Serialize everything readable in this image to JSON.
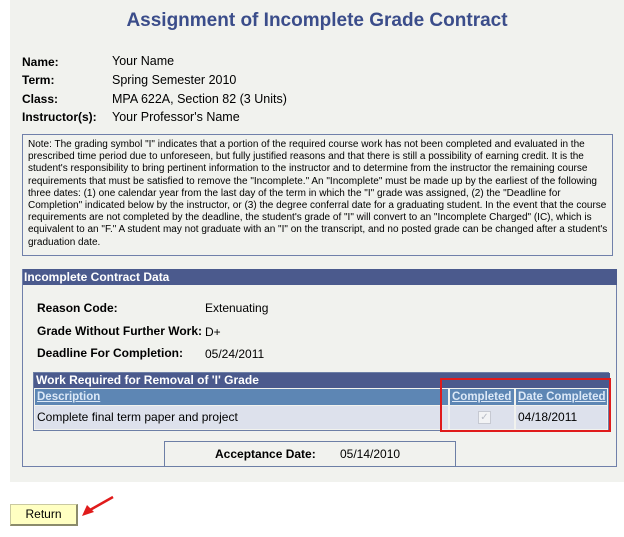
{
  "page": {
    "title": "Assignment of Incomplete Grade Contract"
  },
  "student_info": {
    "name_label": "Name:",
    "name_value": "Your Name",
    "term_label": "Term:",
    "term_value": "Spring Semester 2010",
    "class_label": "Class:",
    "class_value": "MPA 622A, Section 82 (3 Units)",
    "instructor_label": "Instructor(s):",
    "instructor_value": "Your Professor's Name"
  },
  "note": "Note: The grading symbol \"I\" indicates that a portion of the required course work has not been completed and evaluated in the prescribed time period due to unforeseen, but fully justified reasons and that there is still a possibility of earning credit. It is the student's responsibility to bring pertinent information to the instructor and to determine from the instructor the remaining course requirements that must be satisfied to remove the \"Incomplete.\" An \"Incomplete\" must be made up by the earliest of the following three dates: (1) one calendar year from the last day of the term in which the \"I\" grade was assigned, (2) the \"Deadline for Completion\" indicated below by the instructor, or (3) the degree conferral date for a graduating student. In the event that the course requirements are not completed by the deadline, the student's grade of \"I\" will convert to an \"Incomplete Charged\" (IC), which is equivalent to an \"F.\" A student may not graduate with an \"I\" on the transcript, and no posted grade can be changed after a student's graduation date.",
  "contract": {
    "header": "Incomplete Contract Data",
    "reason_label": "Reason Code:",
    "reason_value": "Extenuating",
    "grade_label": "Grade Without Further Work:",
    "grade_value": "D+",
    "deadline_label": "Deadline For Completion:",
    "deadline_value": "05/24/2011",
    "work": {
      "header": "Work Required for Removal of 'I' Grade",
      "columns": [
        "Description",
        "Completed",
        "Date Completed"
      ],
      "rows": [
        {
          "description": "Complete final term paper and project",
          "completed": true,
          "date_completed": "04/18/2011"
        }
      ]
    },
    "acceptance_label": "Acceptance Date:",
    "acceptance_value": "05/14/2010"
  },
  "buttons": {
    "return_label": "Return"
  },
  "annotations": {
    "highlight_color": "#e01b1b"
  }
}
